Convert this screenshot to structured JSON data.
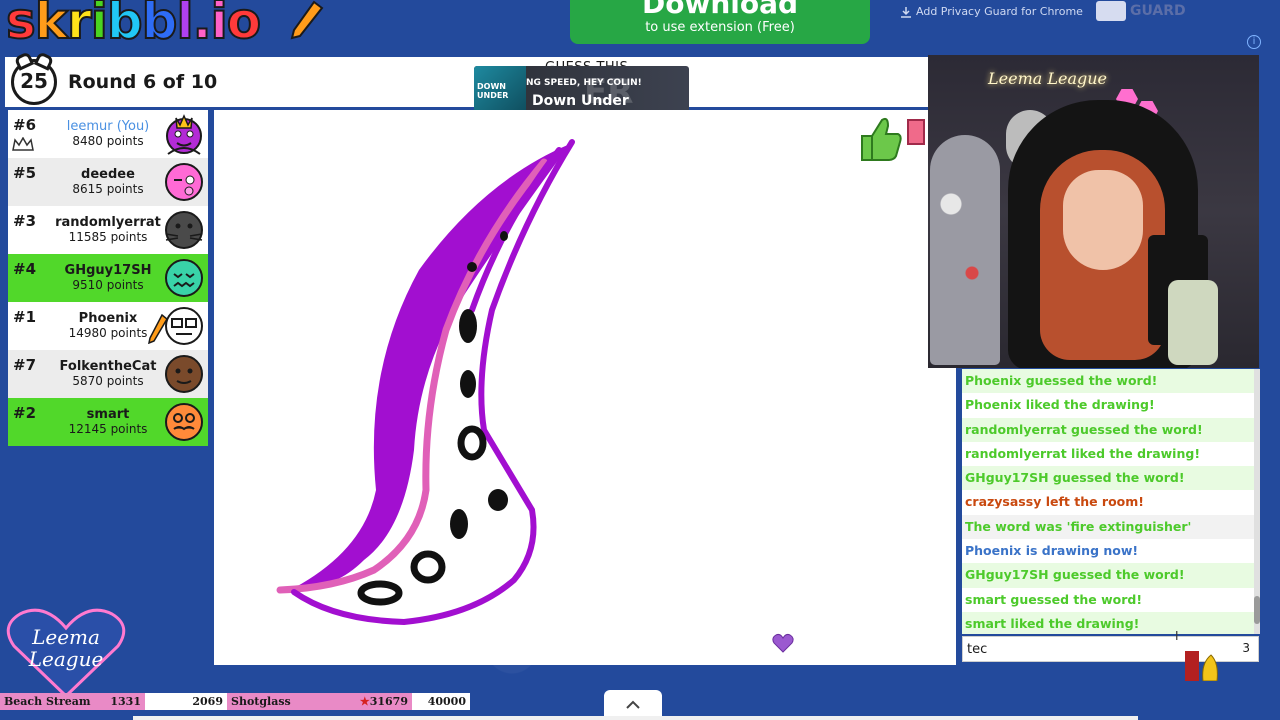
{
  "header": {
    "logo_text": "skribbl.io",
    "download_title": "Download",
    "download_sub": "to use extension (Free)",
    "extension_link": "Add Privacy Guard for Chrome",
    "guard_label": "GUARD"
  },
  "game": {
    "timer": "25",
    "round": "Round 6 of 10",
    "guess_label": "GUESS THIS",
    "ad_line1": "NG SPEED, HEY COLIN!",
    "ad_line2": "Down Under",
    "ad_thumb": "DOWN UNDER",
    "ad_ghost": "ER"
  },
  "players": [
    {
      "rank": "#6",
      "name": "leemur (You)",
      "points": "8480 points"
    },
    {
      "rank": "#5",
      "name": "deedee",
      "points": "8615 points"
    },
    {
      "rank": "#3",
      "name": "randomlyerrat",
      "points": "11585 points"
    },
    {
      "rank": "#4",
      "name": "GHguy17SH",
      "points": "9510 points"
    },
    {
      "rank": "#1",
      "name": "Phoenix",
      "points": "14980 points"
    },
    {
      "rank": "#7",
      "name": "FolkentheCat",
      "points": "5870 points"
    },
    {
      "rank": "#2",
      "name": "smart",
      "points": "12145 points"
    }
  ],
  "webcam": {
    "neon_sign": "Leema League"
  },
  "chat": {
    "messages": [
      "Phoenix guessed the word!",
      "Phoenix liked the drawing!",
      "randomlyerrat guessed the word!",
      "randomlyerrat liked the drawing!",
      "GHguy17SH guessed the word!",
      "crazysassy left the room!",
      "The word was 'fire extinguisher'",
      "Phoenix is drawing now!",
      "GHguy17SH guessed the word!",
      "smart guessed the word!",
      "smart liked the drawing!"
    ],
    "input_value": "tec",
    "char_count": "3"
  },
  "overlay": {
    "logo_line1": "Leema",
    "logo_line2": "League",
    "bar1_label": "Beach Stream",
    "bar1_value": "1331",
    "bar2_value": "2069",
    "bar3_label": "Shotglass",
    "bar3_value": "31679",
    "bar4_value": "40000"
  },
  "colors": {
    "accent_green": "#51d82a",
    "download_green": "#27a745",
    "drawing_purple": "#a20fd0",
    "drawing_pink": "#e060b8",
    "background_blue": "#234a9c"
  }
}
